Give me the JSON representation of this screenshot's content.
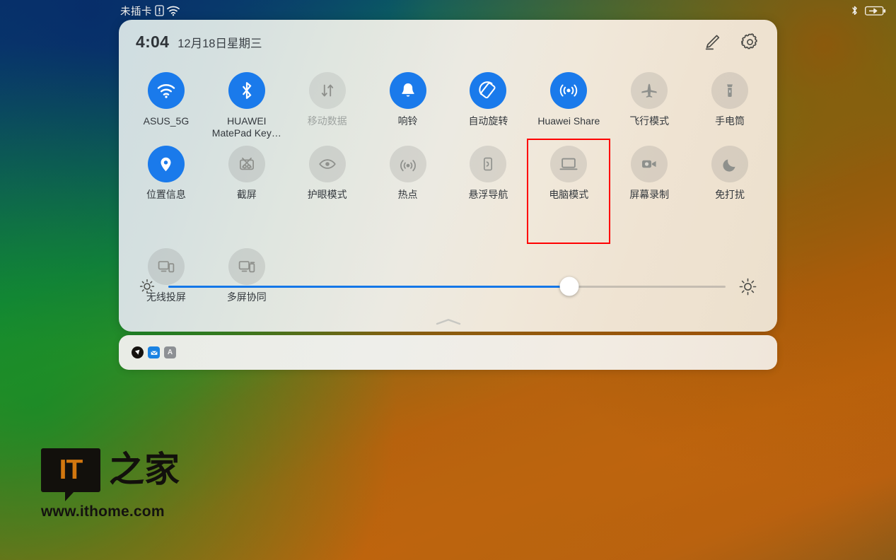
{
  "status_bar": {
    "carrier_text": "未插卡",
    "icons_left": [
      "sim-missing-icon",
      "wifi-icon"
    ],
    "icons_right": [
      "bluetooth-icon",
      "battery-charging-icon"
    ]
  },
  "control_panel": {
    "clock": {
      "time": "4:04",
      "date": "12月18日星期三"
    },
    "header_actions": [
      {
        "name": "edit-button",
        "icon": "pencil-icon"
      },
      {
        "name": "settings-button",
        "icon": "gear-icon"
      }
    ],
    "tiles": [
      {
        "label": "ASUS_5G",
        "icon": "wifi-icon",
        "state": "on"
      },
      {
        "label": "HUAWEI\nMatePad Key…",
        "icon": "bluetooth-icon",
        "state": "on"
      },
      {
        "label": "移动数据",
        "icon": "mobile-data-icon",
        "state": "disabled"
      },
      {
        "label": "响铃",
        "icon": "bell-icon",
        "state": "on"
      },
      {
        "label": "自动旋转",
        "icon": "auto-rotate-icon",
        "state": "on"
      },
      {
        "label": "Huawei Share",
        "icon": "huawei-share-icon",
        "state": "on"
      },
      {
        "label": "飞行模式",
        "icon": "airplane-icon",
        "state": "off"
      },
      {
        "label": "手电筒",
        "icon": "flashlight-icon",
        "state": "off"
      },
      {
        "label": "位置信息",
        "icon": "location-pin-icon",
        "state": "on"
      },
      {
        "label": "截屏",
        "icon": "screenshot-icon",
        "state": "off"
      },
      {
        "label": "护眼模式",
        "icon": "eye-comfort-icon",
        "state": "off"
      },
      {
        "label": "热点",
        "icon": "hotspot-icon",
        "state": "off"
      },
      {
        "label": "悬浮导航",
        "icon": "floating-nav-icon",
        "state": "off"
      },
      {
        "label": "电脑模式",
        "icon": "laptop-icon",
        "state": "off",
        "highlighted": true
      },
      {
        "label": "屏幕录制",
        "icon": "screen-record-icon",
        "state": "off"
      },
      {
        "label": "免打扰",
        "icon": "moon-icon",
        "state": "off"
      },
      {
        "label": "无线投屏",
        "icon": "cast-screen-icon",
        "state": "off"
      },
      {
        "label": "多屏协同",
        "icon": "multi-screen-icon",
        "state": "off"
      }
    ],
    "brightness": {
      "low_icon": "brightness-low-icon",
      "high_icon": "brightness-high-icon",
      "value_percent": 72
    },
    "handle_icon": "chevron-up-icon",
    "highlight_color": "#ff0000",
    "accent_color": "#1a7aeb"
  },
  "notification_card": {
    "icons": [
      "app-black-icon",
      "app-blue-icon",
      "app-letter-a-icon"
    ]
  },
  "watermark": {
    "logo_text": "IT",
    "logo_cn": "之家",
    "url": "www.ithome.com"
  }
}
